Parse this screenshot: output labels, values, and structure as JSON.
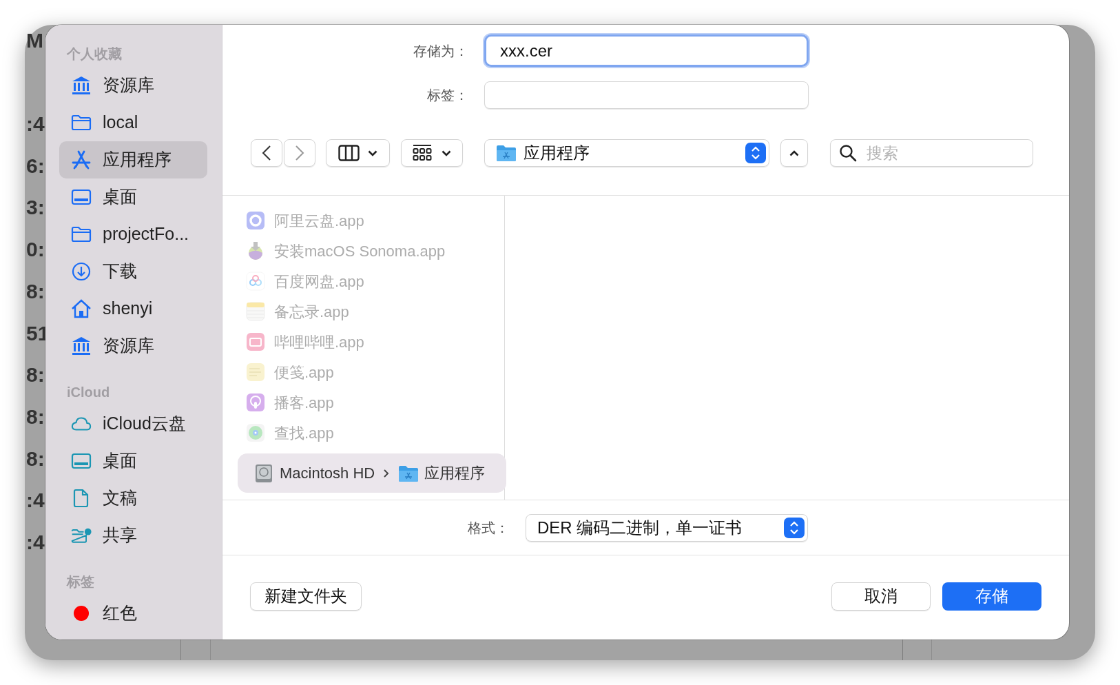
{
  "background_window": {
    "fragments": [
      "M",
      ":4",
      "6:",
      "3:",
      "0:",
      "8:",
      "51",
      "8:",
      "8:",
      "8:",
      ":4",
      ":4"
    ]
  },
  "sidebar": {
    "sections": [
      {
        "title": "个人收藏",
        "items": [
          {
            "label": "资源库",
            "kind": "library",
            "selected": false
          },
          {
            "label": "local",
            "kind": "folder",
            "selected": false
          },
          {
            "label": "应用程序",
            "kind": "apps",
            "selected": true
          },
          {
            "label": "桌面",
            "kind": "desktop",
            "selected": false
          },
          {
            "label": "projectFo...",
            "kind": "folder",
            "selected": false
          },
          {
            "label": "下载",
            "kind": "download",
            "selected": false
          },
          {
            "label": "shenyi",
            "kind": "home",
            "selected": false
          },
          {
            "label": "资源库",
            "kind": "library",
            "selected": false
          }
        ]
      },
      {
        "title": "iCloud",
        "items": [
          {
            "label": "iCloud云盘",
            "kind": "cloud",
            "selected": false
          },
          {
            "label": "桌面",
            "kind": "desktop",
            "selected": false
          },
          {
            "label": "文稿",
            "kind": "document",
            "selected": false
          },
          {
            "label": "共享",
            "kind": "shared",
            "selected": false
          }
        ]
      },
      {
        "title": "标签",
        "items": [
          {
            "label": "红色",
            "kind": "tag",
            "color": "#ff0000",
            "selected": false
          }
        ]
      }
    ]
  },
  "save_as": {
    "label": "存储为：",
    "value": "xxx.cer",
    "focused": true
  },
  "tags": {
    "label": "标签："
  },
  "toolbar": {
    "location": "应用程序",
    "search_placeholder": "搜索"
  },
  "files": [
    {
      "name": "阿里云盘.app",
      "kind": "aliyun",
      "disabled": true
    },
    {
      "name": "安装macOS Sonoma.app",
      "kind": "installer",
      "disabled": true
    },
    {
      "name": "百度网盘.app",
      "kind": "baidu",
      "disabled": true
    },
    {
      "name": "备忘录.app",
      "kind": "notes",
      "disabled": true
    },
    {
      "name": "哔哩哔哩.app",
      "kind": "bilibili",
      "disabled": true
    },
    {
      "name": "便笺.app",
      "kind": "stickies",
      "disabled": true
    },
    {
      "name": "播客.app",
      "kind": "podcasts",
      "disabled": true
    },
    {
      "name": "查找.app",
      "kind": "findmy",
      "disabled": true
    }
  ],
  "path_bar": [
    "Macintosh HD",
    "应用程序"
  ],
  "format": {
    "label": "格式：",
    "value": "DER 编码二进制，单一证书"
  },
  "buttons": {
    "new_folder": "新建文件夹",
    "cancel": "取消",
    "save": "存储"
  }
}
